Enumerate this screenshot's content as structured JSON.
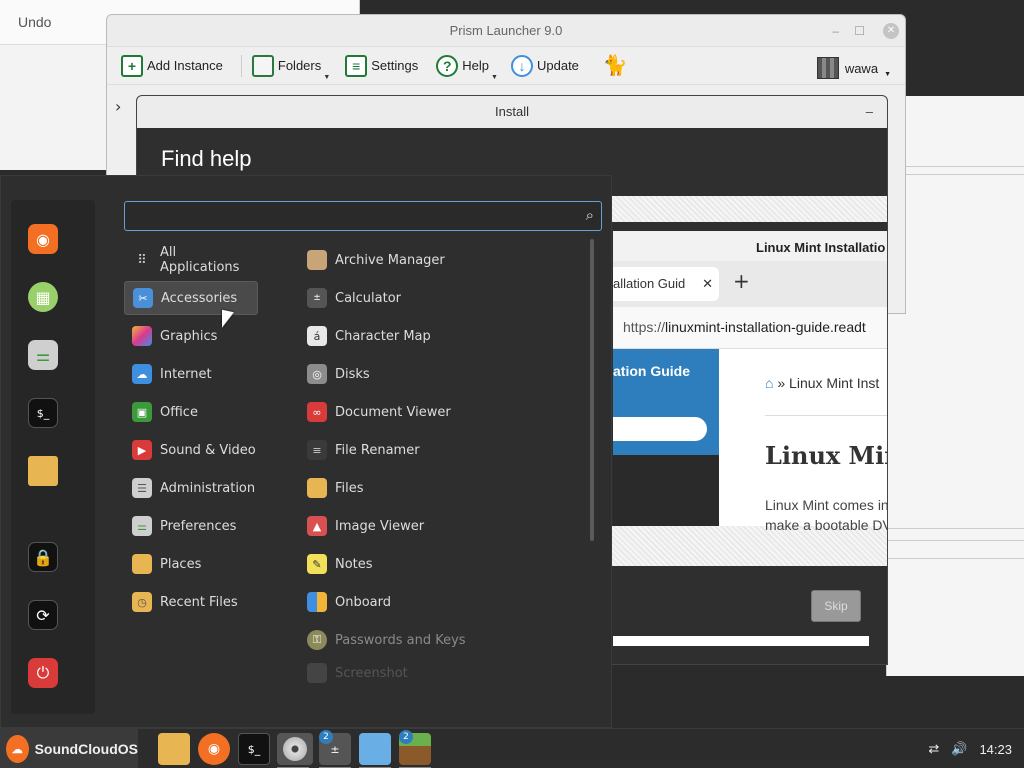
{
  "background": {
    "undo_label": "Undo"
  },
  "prism": {
    "title": "Prism Launcher 9.0",
    "toolbar": [
      {
        "label": "Add Instance",
        "icon": "plus"
      },
      {
        "label": "Folders",
        "icon": "folder"
      },
      {
        "label": "Settings",
        "icon": "settings"
      },
      {
        "label": "Help",
        "icon": "help"
      },
      {
        "label": "Update",
        "icon": "cloud-download"
      }
    ],
    "username": "wawa"
  },
  "install": {
    "title": "Install",
    "heading": "Find help",
    "skip_label": "Skip",
    "browser": {
      "window_title": "Linux Mint Installatio",
      "tab_label": "allation Guid",
      "tab_close": "✕",
      "new_tab": "+",
      "url_prefix": "https://",
      "url_path": "linuxmint-installation-guide.readt",
      "sidebar_title": "ation Guide",
      "breadcrumb_sep": "»",
      "breadcrumb": "Linux Mint Inst",
      "heading": "Linux Min",
      "para_line1": "Linux Mint comes in",
      "para_line2": "make a bootable DV"
    }
  },
  "menu": {
    "search_placeholder": "",
    "categories": [
      {
        "label": "All Applications",
        "icon": "grid-icon",
        "color": "#2e2e2e"
      },
      {
        "label": "Accessories",
        "icon": "scissors-icon",
        "color": "#4a90d9"
      },
      {
        "label": "Graphics",
        "icon": "graphics-icon",
        "color": "#c43c8f"
      },
      {
        "label": "Internet",
        "icon": "cloud-icon",
        "color": "#3e8fe0"
      },
      {
        "label": "Office",
        "icon": "office-icon",
        "color": "#3b9b3b"
      },
      {
        "label": "Sound & Video",
        "icon": "play-icon",
        "color": "#d93a3a"
      },
      {
        "label": "Administration",
        "icon": "admin-icon",
        "color": "#cfcfcf"
      },
      {
        "label": "Preferences",
        "icon": "prefs-icon",
        "color": "#cfcfcf"
      },
      {
        "label": "Places",
        "icon": "folder-icon",
        "color": "#e8b553"
      },
      {
        "label": "Recent Files",
        "icon": "recent-icon",
        "color": "#e8b553"
      }
    ],
    "apps": [
      {
        "label": "Archive Manager",
        "icon": "archive-icon",
        "color": "#c9a478"
      },
      {
        "label": "Calculator",
        "icon": "calculator-icon",
        "color": "#555555"
      },
      {
        "label": "Character Map",
        "icon": "charmap-icon",
        "color": "#e8e8e8"
      },
      {
        "label": "Disks",
        "icon": "disks-icon",
        "color": "#8c8c8c"
      },
      {
        "label": "Document Viewer",
        "icon": "docviewer-icon",
        "color": "#d93a3a"
      },
      {
        "label": "File Renamer",
        "icon": "renamer-icon",
        "color": "#3a3a3a"
      },
      {
        "label": "Files",
        "icon": "files-icon",
        "color": "#e8b553"
      },
      {
        "label": "Image Viewer",
        "icon": "image-icon",
        "color": "#d95050"
      },
      {
        "label": "Notes",
        "icon": "notes-icon",
        "color": "#f2e05a"
      },
      {
        "label": "Onboard",
        "icon": "onboard-icon",
        "color": "#3e8fe0"
      },
      {
        "label": "Passwords and Keys",
        "icon": "keys-icon",
        "color": "#8a8a5a"
      },
      {
        "label": "Screenshot",
        "icon": "screenshot-icon",
        "color": "#444444"
      }
    ],
    "favorites": [
      "firefox-icon",
      "network-icon",
      "settings-toggle-icon",
      "terminal-icon",
      "folder-icon",
      "lock-icon",
      "logout-icon",
      "power-icon"
    ]
  },
  "taskbar": {
    "start_label": "SoundCloudOS",
    "apps": [
      {
        "name": "files-folder",
        "badge": ""
      },
      {
        "name": "firefox",
        "badge": ""
      },
      {
        "name": "terminal",
        "badge": ""
      },
      {
        "name": "disc",
        "badge": ""
      },
      {
        "name": "calculator",
        "badge": "2"
      },
      {
        "name": "screen",
        "badge": ""
      },
      {
        "name": "minecraft",
        "badge": "2"
      }
    ],
    "clock": "14:23"
  }
}
